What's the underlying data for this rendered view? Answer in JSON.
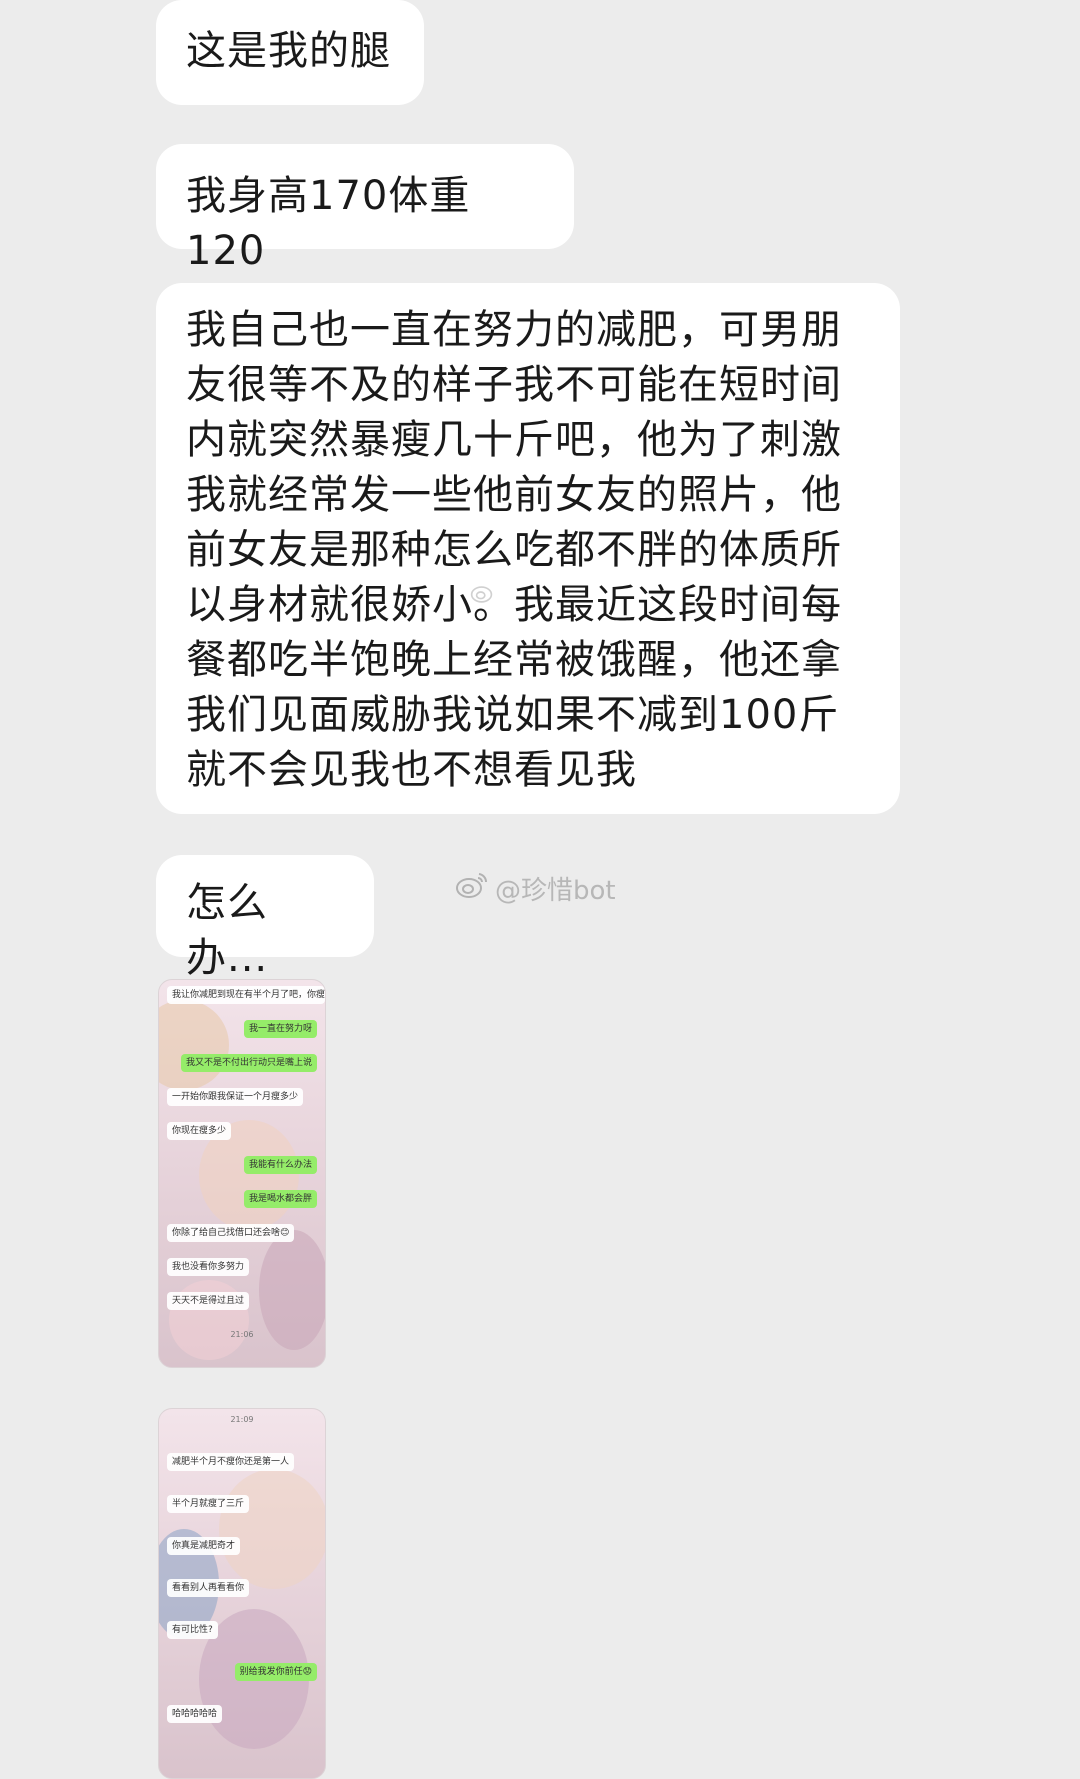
{
  "messages": [
    {
      "text": "这是我的腿"
    },
    {
      "text": "我身高170体重120"
    },
    {
      "lines": [
        "我自己也一直在努力的减肥，可男朋",
        "友很等不及的样子我不可能在短时间",
        "内就突然暴瘦几十斤吧，他为了刺激",
        "我就经常发一些他前女友的照片，他",
        "前女友是那种怎么吃都不胖的体质所",
        "以身材就很娇小。我最近这段时间每",
        "餐都吃半饱晚上经常被饿醒，他还拿",
        "我们见面威胁我说如果不减到100斤",
        "就不会见我也不想看见我"
      ]
    },
    {
      "text": "怎么办..."
    }
  ],
  "screenshot1": {
    "items": [
      {
        "side": "l",
        "text": "我让你减肥到现在有半个月了吧，你瘦多少?"
      },
      {
        "side": "r",
        "text": "我一直在努力呀"
      },
      {
        "side": "r",
        "text": "我又不是不付出行动只是嘴上说"
      },
      {
        "side": "l",
        "text": "一开始你跟我保证一个月瘦多少"
      },
      {
        "side": "l",
        "text": "你现在瘦多少"
      },
      {
        "side": "r",
        "text": "我能有什么办法"
      },
      {
        "side": "r",
        "text": "我是喝水都会胖"
      },
      {
        "side": "l",
        "text": "你除了给自己找借口还会啥😊"
      },
      {
        "side": "l",
        "text": "我也没看你多努力"
      },
      {
        "side": "l",
        "text": "天天不是得过且过"
      },
      {
        "side": "t",
        "text": "21:06"
      }
    ]
  },
  "screenshot2": {
    "items": [
      {
        "side": "t",
        "text": "21:09"
      },
      {
        "side": "l",
        "text": "减肥半个月不瘦你还是第一人"
      },
      {
        "side": "l",
        "text": "半个月就瘦了三斤"
      },
      {
        "side": "l",
        "text": "你真是减肥奇才"
      },
      {
        "side": "l",
        "text": "看看别人再看看你"
      },
      {
        "side": "l",
        "text": "有可比性?"
      },
      {
        "side": "r",
        "text": "别给我发你前任😟"
      },
      {
        "side": "l",
        "text": "哈哈哈哈哈"
      }
    ]
  },
  "watermark": {
    "text": "@珍惜bot",
    "icon": "weibo-icon"
  }
}
